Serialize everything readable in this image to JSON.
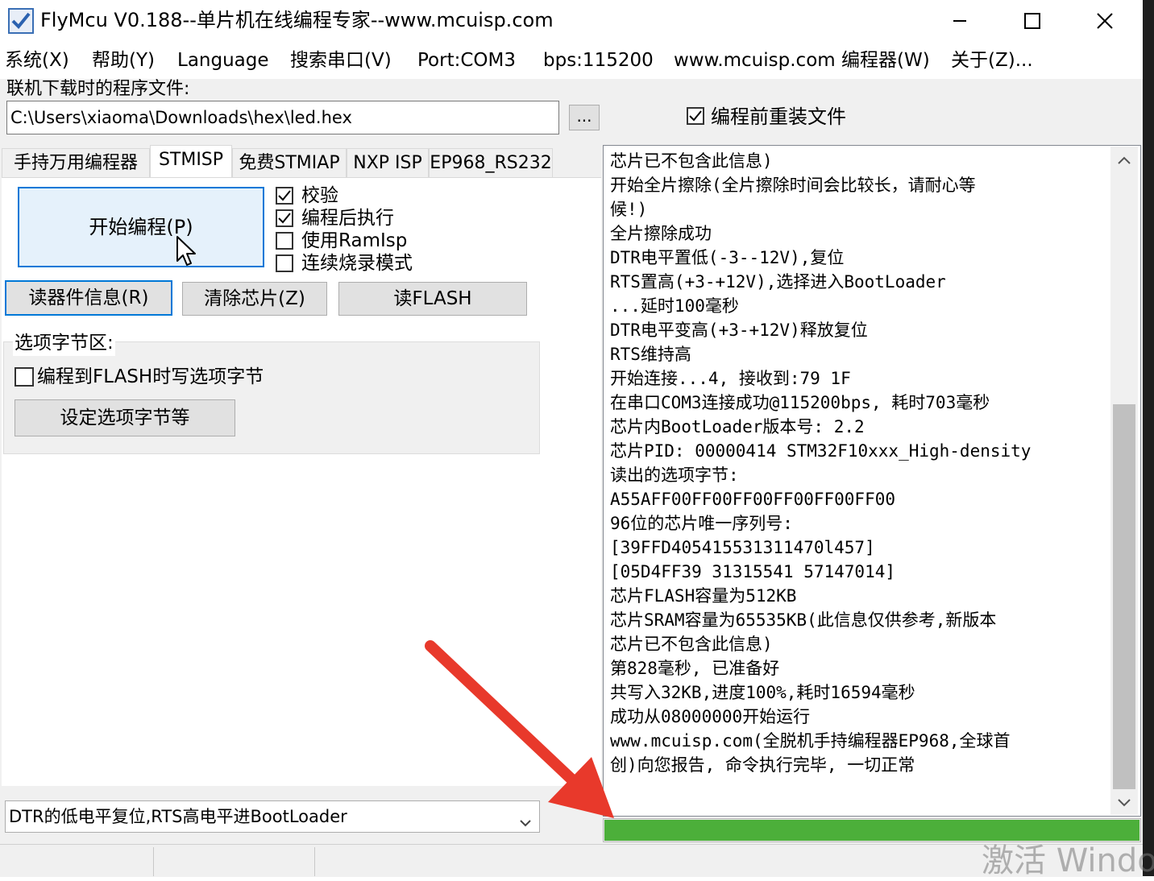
{
  "window": {
    "title": "FlyMcu V0.188--单片机在线编程专家--www.mcuisp.com",
    "controls": [
      "minimize",
      "maximize",
      "close"
    ]
  },
  "menu": {
    "items": [
      "系统(X)",
      "帮助(Y)",
      "Language",
      "搜索串口(V)",
      "Port:COM3",
      "bps:115200",
      "www.mcuisp.com 编程器(W)",
      "关于(Z)..."
    ]
  },
  "file": {
    "label": "联机下载时的程序文件:",
    "path": "C:\\Users\\xiaoma\\Downloads\\hex\\led.hex",
    "browse_label": "...",
    "reload_label": "编程前重装文件",
    "reload_checked": true
  },
  "tabs": [
    {
      "label": "手持万用编程器",
      "active": false
    },
    {
      "label": "STMISP",
      "active": true
    },
    {
      "label": "免费STMIAP",
      "active": false
    },
    {
      "label": "NXP ISP",
      "active": false
    },
    {
      "label": "EP968_RS232",
      "active": false
    }
  ],
  "stmisp": {
    "start_button": "开始编程(P)",
    "options": [
      {
        "label": "校验",
        "checked": true
      },
      {
        "label": "编程后执行",
        "checked": true
      },
      {
        "label": "使用RamIsp",
        "checked": false
      },
      {
        "label": "连续烧录模式",
        "checked": false
      }
    ],
    "read_info_button": "读器件信息(R)",
    "erase_button": "清除芯片(Z)",
    "read_flash_button": "读FLASH",
    "option_group_title": "选项字节区:",
    "option_write_label": "编程到FLASH时写选项字节",
    "option_write_checked": false,
    "option_set_button": "设定选项字节等"
  },
  "reset_mode": {
    "selected": "DTR的低电平复位,RTS高电平进BootLoader"
  },
  "log": {
    "lines": [
      "芯片已不包含此信息)",
      "开始全片擦除(全片擦除时间会比较长，请耐心等",
      "候!)",
      "全片擦除成功",
      "DTR电平置低(-3--12V),复位",
      "RTS置高(+3-+12V),选择进入BootLoader",
      "...延时100毫秒",
      "DTR电平变高(+3-+12V)释放复位",
      "RTS维持高",
      "开始连接...4, 接收到:79 1F",
      "在串口COM3连接成功@115200bps, 耗时703毫秒",
      "芯片内BootLoader版本号: 2.2",
      "芯片PID: 00000414  STM32F10xxx_High-density",
      "读出的选项字节:",
      "A55AFF00FF00FF00FF00FF00FF00",
      "96位的芯片唯一序列号:",
      "[39FFD405415531311470l457]",
      "[05D4FF39 31315541 57147014]",
      "芯片FLASH容量为512KB",
      "芯片SRAM容量为65535KB(此信息仅供参考,新版本",
      "芯片已不包含此信息)",
      "第828毫秒, 已准备好",
      "共写入32KB,进度100%,耗时16594毫秒",
      "成功从08000000开始运行",
      "www.mcuisp.com(全脱机手持编程器EP968,全球首",
      "创)向您报告, 命令执行完毕, 一切正常"
    ]
  },
  "progress": {
    "fraction": 1.0,
    "color": "#4caf3a"
  },
  "watermark": "激活 Windo",
  "colors": {
    "accent": "#0078d7",
    "arrow": "#e8392b"
  }
}
